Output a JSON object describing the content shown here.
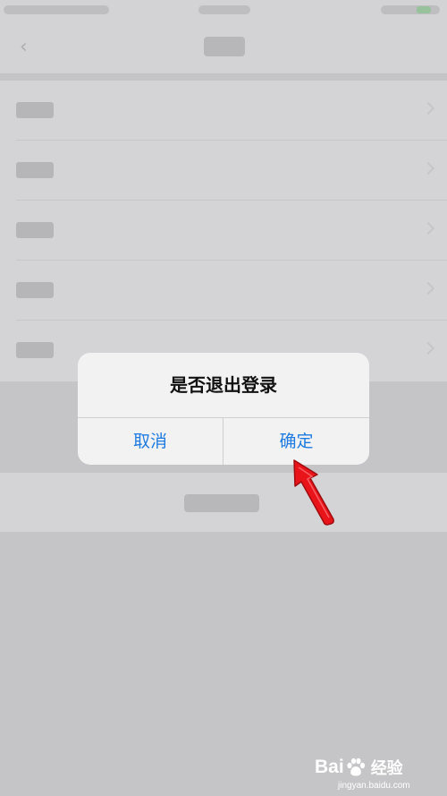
{
  "alert": {
    "title": "是否退出登录",
    "cancel_label": "取消",
    "confirm_label": "确定"
  },
  "watermark": {
    "logo_text_a": "Bai",
    "logo_text_b": "经验",
    "url": "jingyan.baidu.com"
  },
  "colors": {
    "accent": "#1e7be0",
    "title_text": "#111111",
    "annotation_arrow": "#e8141a"
  },
  "icons": {
    "back": "chevron-left",
    "row_indicator": "chevron-right"
  }
}
